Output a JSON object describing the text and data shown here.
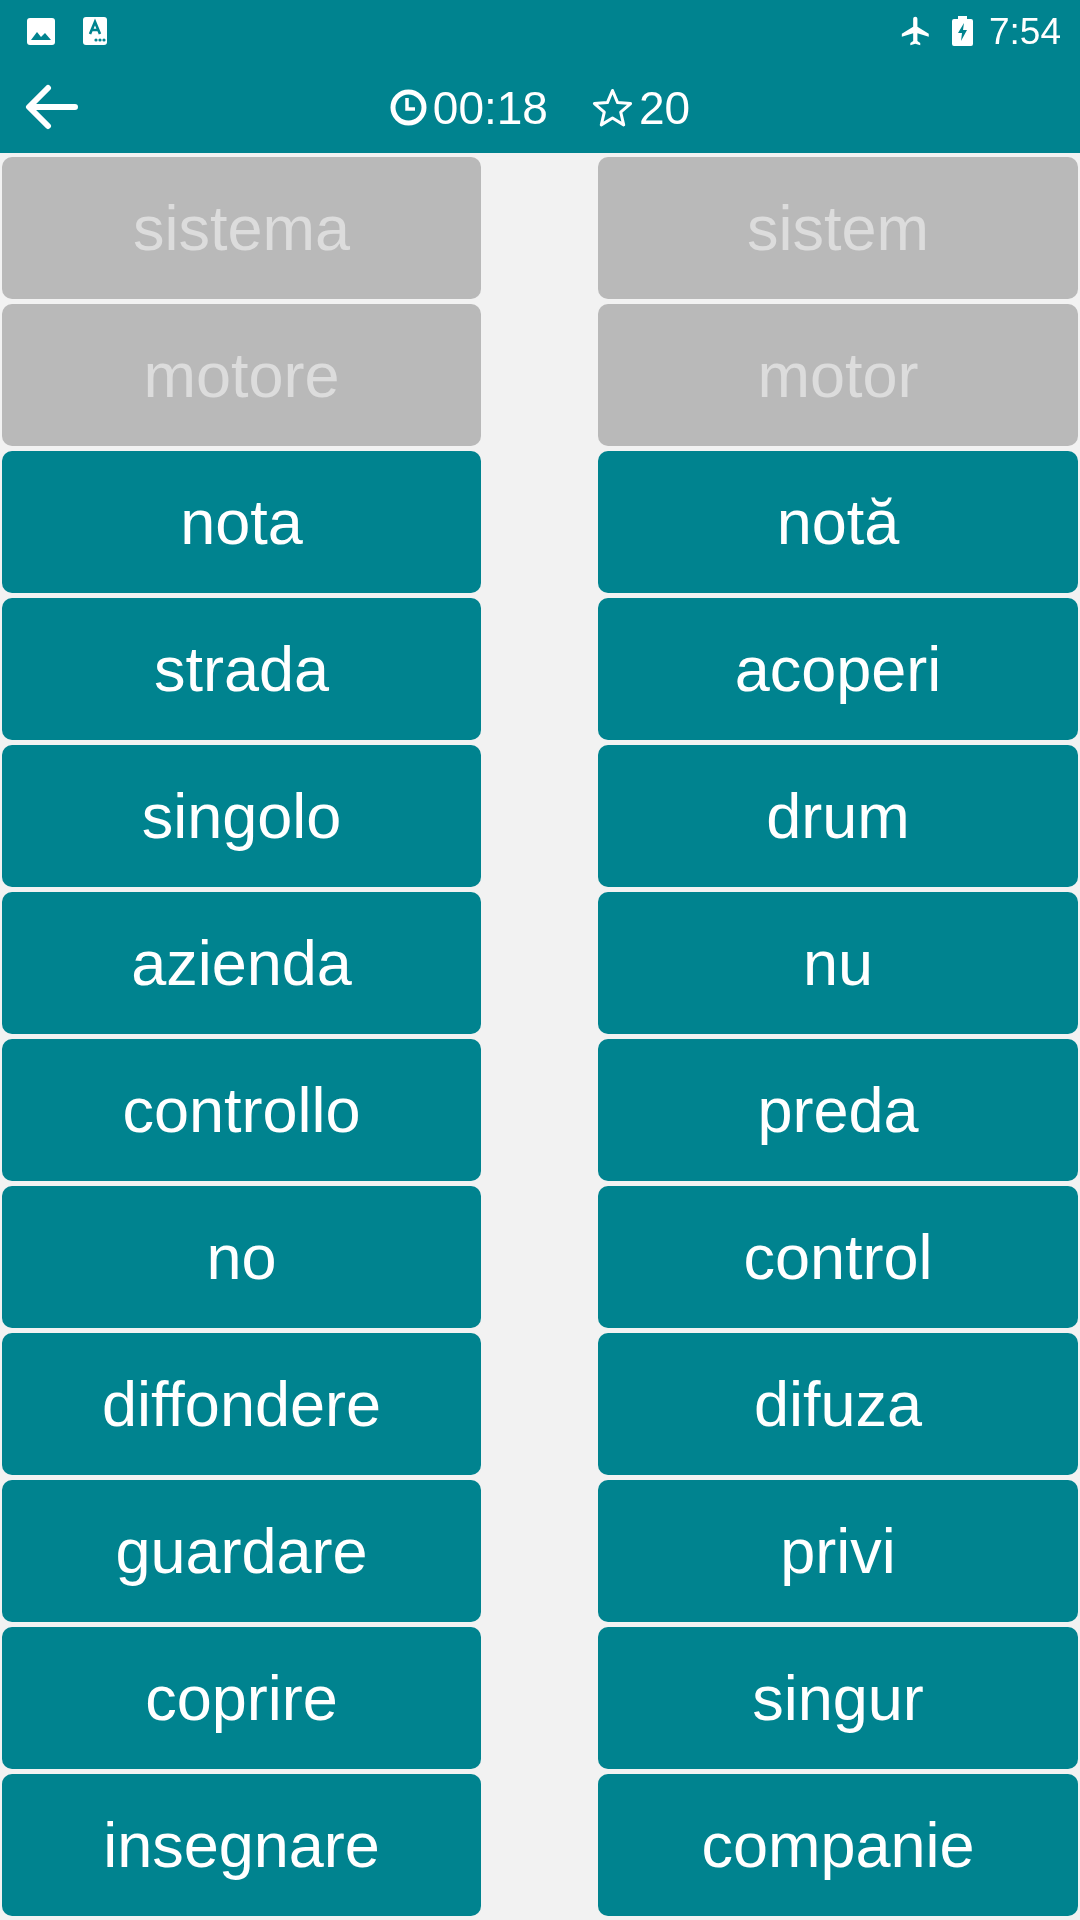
{
  "status_bar": {
    "time": "7:54"
  },
  "header": {
    "timer": "00:18",
    "score": "20"
  },
  "rows": [
    {
      "left": {
        "text": "sistema",
        "matched": true
      },
      "right": {
        "text": "sistem",
        "matched": true
      }
    },
    {
      "left": {
        "text": "motore",
        "matched": true
      },
      "right": {
        "text": "motor",
        "matched": true
      }
    },
    {
      "left": {
        "text": "nota",
        "matched": false
      },
      "right": {
        "text": "notă",
        "matched": false
      }
    },
    {
      "left": {
        "text": "strada",
        "matched": false
      },
      "right": {
        "text": "acoperi",
        "matched": false
      }
    },
    {
      "left": {
        "text": "singolo",
        "matched": false
      },
      "right": {
        "text": "drum",
        "matched": false
      }
    },
    {
      "left": {
        "text": "azienda",
        "matched": false
      },
      "right": {
        "text": "nu",
        "matched": false
      }
    },
    {
      "left": {
        "text": "controllo",
        "matched": false
      },
      "right": {
        "text": "preda",
        "matched": false
      }
    },
    {
      "left": {
        "text": "no",
        "matched": false
      },
      "right": {
        "text": "control",
        "matched": false
      }
    },
    {
      "left": {
        "text": "diffondere",
        "matched": false
      },
      "right": {
        "text": "difuza",
        "matched": false
      }
    },
    {
      "left": {
        "text": "guardare",
        "matched": false
      },
      "right": {
        "text": "privi",
        "matched": false
      }
    },
    {
      "left": {
        "text": "coprire",
        "matched": false
      },
      "right": {
        "text": "singur",
        "matched": false
      }
    },
    {
      "left": {
        "text": "insegnare",
        "matched": false
      },
      "right": {
        "text": "companie",
        "matched": false
      }
    }
  ]
}
